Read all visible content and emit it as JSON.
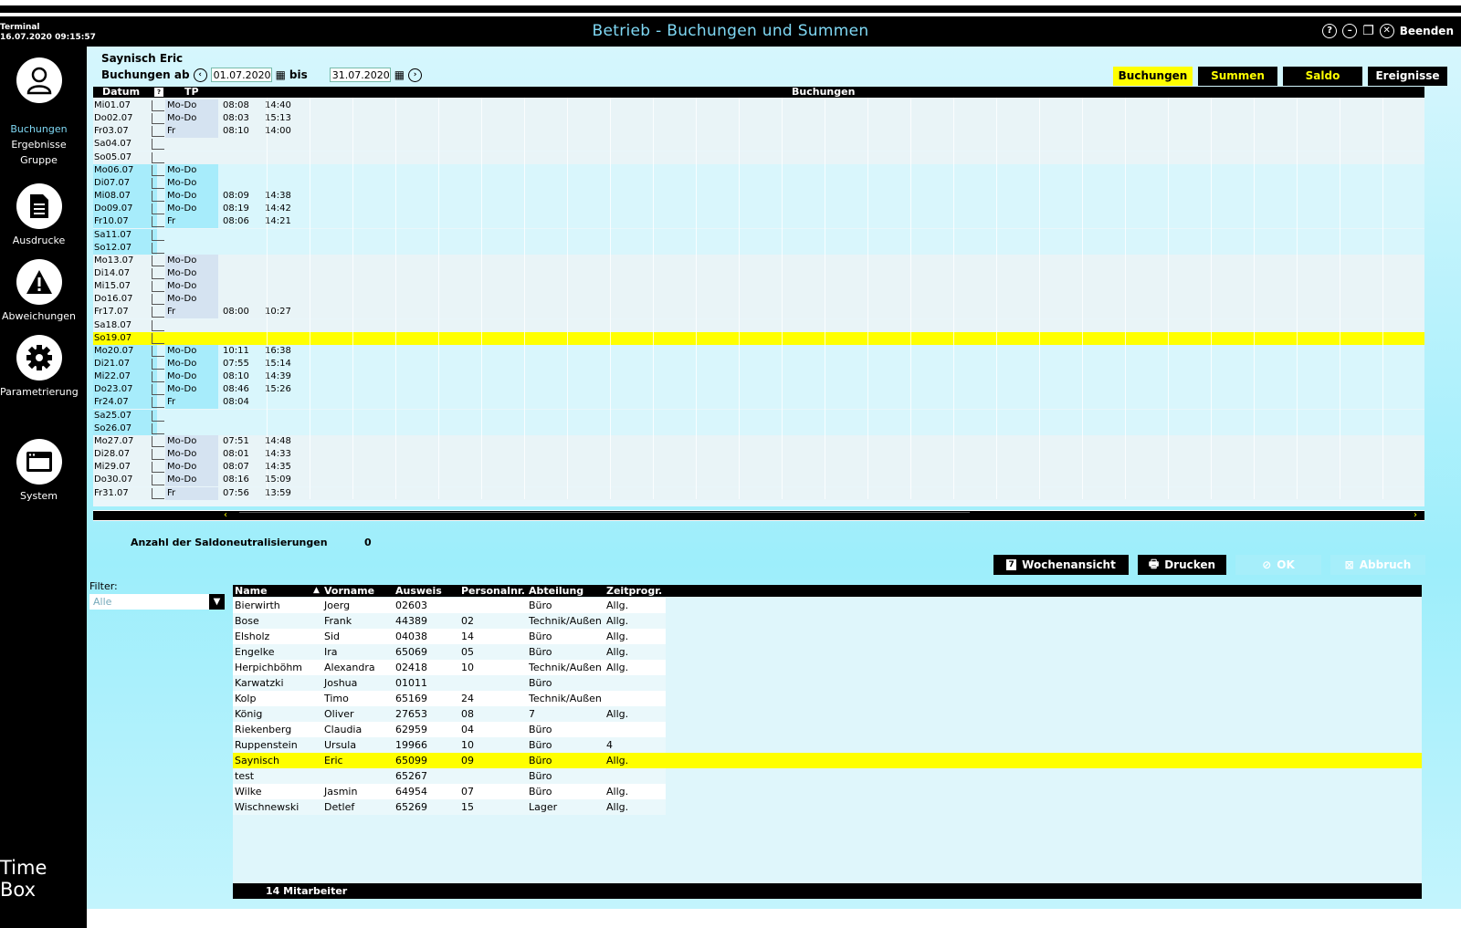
{
  "window": {
    "terminal": "Terminal",
    "datetime": "16.07.2020 09:15:57",
    "title": "Betrieb - Buchungen und Summen",
    "close_label": "Beenden"
  },
  "sidebar": {
    "items": [
      {
        "label": "Buchungen",
        "icon": "user-icon"
      },
      {
        "label": "Ergebnisse",
        "icon": null
      },
      {
        "label": "Gruppe",
        "icon": null
      },
      {
        "label": "Ausdrucke",
        "icon": "document-icon"
      },
      {
        "label": "Abweichungen",
        "icon": "warning-icon"
      },
      {
        "label": "Parametrierung",
        "icon": "gear-icon"
      },
      {
        "label": "System",
        "icon": "window-icon"
      }
    ],
    "brand": "Time Box"
  },
  "header": {
    "person": "Saynisch Eric",
    "range_label": "Buchungen ab",
    "from_date": "01.07.2020",
    "to_label": "bis",
    "to_date": "31.07.2020"
  },
  "tabs": [
    "Buchungen",
    "Summen",
    "Saldo",
    "Ereignisse"
  ],
  "grid": {
    "headers": {
      "date": "Datum",
      "tp": "TP",
      "bookings": "Buchungen"
    },
    "rows": [
      {
        "d": "Mi01.07",
        "tp": "Mo-Do",
        "t1": "08:08",
        "t2": "14:40"
      },
      {
        "d": "Do02.07",
        "tp": "Mo-Do",
        "t1": "08:03",
        "t2": "15:13"
      },
      {
        "d": "Fr03.07",
        "tp": "Fr",
        "t1": "08:10",
        "t2": "14:00"
      },
      {
        "d": "Sa04.07",
        "tp": "",
        "t1": "",
        "t2": ""
      },
      {
        "d": "So05.07",
        "tp": "",
        "t1": "",
        "t2": ""
      },
      {
        "d": "Mo06.07",
        "tp": "Mo-Do",
        "t1": "",
        "t2": ""
      },
      {
        "d": "Di07.07",
        "tp": "Mo-Do",
        "t1": "",
        "t2": ""
      },
      {
        "d": "Mi08.07",
        "tp": "Mo-Do",
        "t1": "08:09",
        "t2": "14:38"
      },
      {
        "d": "Do09.07",
        "tp": "Mo-Do",
        "t1": "08:19",
        "t2": "14:42"
      },
      {
        "d": "Fr10.07",
        "tp": "Fr",
        "t1": "08:06",
        "t2": "14:21"
      },
      {
        "d": "Sa11.07",
        "tp": "",
        "t1": "",
        "t2": ""
      },
      {
        "d": "So12.07",
        "tp": "",
        "t1": "",
        "t2": ""
      },
      {
        "d": "Mo13.07",
        "tp": "Mo-Do",
        "t1": "",
        "t2": ""
      },
      {
        "d": "Di14.07",
        "tp": "Mo-Do",
        "t1": "",
        "t2": ""
      },
      {
        "d": "Mi15.07",
        "tp": "Mo-Do",
        "t1": "",
        "t2": ""
      },
      {
        "d": "Do16.07",
        "tp": "Mo-Do",
        "t1": "",
        "t2": ""
      },
      {
        "d": "Fr17.07",
        "tp": "Fr",
        "t1": "08:00",
        "t2": "10:27"
      },
      {
        "d": "Sa18.07",
        "tp": "",
        "t1": "",
        "t2": ""
      },
      {
        "d": "So19.07",
        "tp": "",
        "t1": "",
        "t2": ""
      },
      {
        "d": "Mo20.07",
        "tp": "Mo-Do",
        "t1": "10:11",
        "t2": "16:38"
      },
      {
        "d": "Di21.07",
        "tp": "Mo-Do",
        "t1": "07:55",
        "t2": "15:14"
      },
      {
        "d": "Mi22.07",
        "tp": "Mo-Do",
        "t1": "08:10",
        "t2": "14:39"
      },
      {
        "d": "Do23.07",
        "tp": "Mo-Do",
        "t1": "08:46",
        "t2": "15:26"
      },
      {
        "d": "Fr24.07",
        "tp": "Fr",
        "t1": "08:04",
        "t2": ""
      },
      {
        "d": "Sa25.07",
        "tp": "",
        "t1": "",
        "t2": ""
      },
      {
        "d": "So26.07",
        "tp": "",
        "t1": "",
        "t2": ""
      },
      {
        "d": "Mo27.07",
        "tp": "Mo-Do",
        "t1": "07:51",
        "t2": "14:48"
      },
      {
        "d": "Di28.07",
        "tp": "Mo-Do",
        "t1": "08:01",
        "t2": "14:33"
      },
      {
        "d": "Mi29.07",
        "tp": "Mo-Do",
        "t1": "08:07",
        "t2": "14:35"
      },
      {
        "d": "Do30.07",
        "tp": "Mo-Do",
        "t1": "08:16",
        "t2": "15:09"
      },
      {
        "d": "Fr31.07",
        "tp": "Fr",
        "t1": "07:56",
        "t2": "13:59"
      }
    ]
  },
  "saldo": {
    "label": "Anzahl der Saldoneutralisierungen",
    "value": "0"
  },
  "buttons": [
    "Wochenansicht",
    "Drucken",
    "OK",
    "Abbruch"
  ],
  "filter": {
    "label": "Filter:",
    "value": "Alle"
  },
  "employees": {
    "headers": [
      "Name",
      "Vorname",
      "Ausweis",
      "Personalnr.",
      "Abteilung",
      "Zeitprogr."
    ],
    "rows": [
      [
        "Bierwirth",
        "Joerg",
        "02603",
        "",
        "Büro",
        "Allg."
      ],
      [
        "Bose",
        "Frank",
        "44389",
        "02",
        "Technik/Außen",
        "Allg."
      ],
      [
        "Elsholz",
        "Sid",
        "04038",
        "14",
        "Büro",
        "Allg."
      ],
      [
        "Engelke",
        "Ira",
        "65069",
        "05",
        "Büro",
        "Allg."
      ],
      [
        "Herpichböhm",
        "Alexandra",
        "02418",
        "10",
        "Technik/Außen",
        "Allg."
      ],
      [
        "Karwatzki",
        "Joshua",
        "01011",
        "",
        "Büro",
        ""
      ],
      [
        "Kolp",
        "Timo",
        "65169",
        "24",
        "Technik/Außen",
        ""
      ],
      [
        "König",
        "Oliver",
        "27653",
        "08",
        "7",
        "Allg."
      ],
      [
        "Riekenberg",
        "Claudia",
        "62959",
        "04",
        "Büro",
        ""
      ],
      [
        "Ruppenstein",
        "Ursula",
        "19966",
        "10",
        "Büro",
        "4"
      ],
      [
        "Saynisch",
        "Eric",
        "65099",
        "09",
        "Büro",
        "Allg."
      ],
      [
        "test",
        "",
        "65267",
        "",
        "Büro",
        ""
      ],
      [
        "Wilke",
        "Jasmin",
        "64954",
        "07",
        "Büro",
        "Allg."
      ],
      [
        "Wischnewski",
        "Detlef",
        "65269",
        "15",
        "Lager",
        "Allg."
      ]
    ],
    "selected": "Saynisch",
    "footer": "14 Mitarbeiter"
  },
  "colors": {
    "highlight": "#ffff00",
    "accent": "#7fd8f4",
    "weekday_block": "#a7ecfb"
  }
}
